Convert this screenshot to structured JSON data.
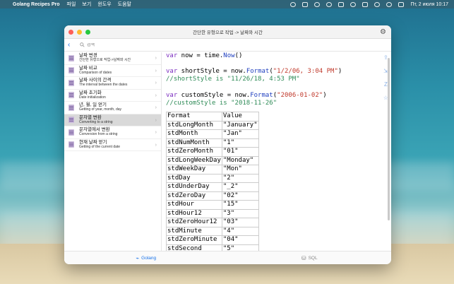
{
  "menubar": {
    "app": "Golang Recipes Pro",
    "items": [
      "파일",
      "보기",
      "윈도우",
      "도움말"
    ],
    "clock": "Пт, 2 июля  10:17"
  },
  "window": {
    "title": "간단한 유형으로 작업 -> 날짜와 시간",
    "search_placeholder": "검색"
  },
  "sidebar": {
    "items": [
      {
        "title": "날짜 변경",
        "subtitle": "간단한 유형으로 작업->날짜와 시간"
      },
      {
        "title": "날짜 비교",
        "subtitle": "Comparison of dates"
      },
      {
        "title": "날짜 사이의 간격",
        "subtitle": "The interval between the dates"
      },
      {
        "title": "날짜 초기화",
        "subtitle": "Date initialization"
      },
      {
        "title": "년, 월, 일 얻기",
        "subtitle": "Getting of year, month, day"
      },
      {
        "title": "문자열 변환",
        "subtitle": "Converting to a string"
      },
      {
        "title": "문자열에서 변환",
        "subtitle": "Conversion from a string"
      },
      {
        "title": "현재 날짜 얻기",
        "subtitle": "Getting of the current date"
      }
    ]
  },
  "code": {
    "l1_kw": "var",
    "l1_rest": " now = time.",
    "l1_fn": "Now",
    "l1_end": "()",
    "l2_kw": "var",
    "l2_rest": " shortStyle = now.",
    "l2_fn": "Format",
    "l2_open": "(",
    "l2_str": "\"1/2/06, 3:04 PM\"",
    "l2_close": ")",
    "l3_comment": "//shortStyle is \"11/26/18, 4:53 PM\"",
    "l4_kw": "var",
    "l4_rest": " customStyle = now.",
    "l4_fn": "Format",
    "l4_open": "(",
    "l4_str": "\"2006-01-02\"",
    "l4_close": ")",
    "l5_comment": "//customStyle is \"2018-11-26\""
  },
  "table": {
    "headers": [
      "Format",
      "Value"
    ],
    "rows": [
      [
        "stdLongMonth",
        "\"January\""
      ],
      [
        "stdMonth",
        "\"Jan\""
      ],
      [
        "stdNumMonth",
        "\"1\""
      ],
      [
        "stdZeroMonth",
        "\"01\""
      ],
      [
        "stdLongWeekDay",
        "\"Monday\""
      ],
      [
        "stdWeekDay",
        "\"Mon\""
      ],
      [
        "stdDay",
        "\"2\""
      ],
      [
        "stdUnderDay",
        "\"_2\""
      ],
      [
        "stdZeroDay",
        "\"02\""
      ],
      [
        "stdHour",
        "\"15\""
      ],
      [
        "stdHour12",
        "\"3\""
      ],
      [
        "stdZeroHour12",
        "\"03\""
      ],
      [
        "stdMinute",
        "\"4\""
      ],
      [
        "stdZeroMinute",
        "\"04\""
      ],
      [
        "stdSecond",
        "\"5\""
      ]
    ]
  },
  "tabs": {
    "golang": "Golang",
    "sql": "SQL"
  },
  "colors": {
    "accent": "#1a73e8",
    "keyword": "#7b2cbf",
    "string": "#c0392b",
    "comment": "#2e8b57"
  }
}
